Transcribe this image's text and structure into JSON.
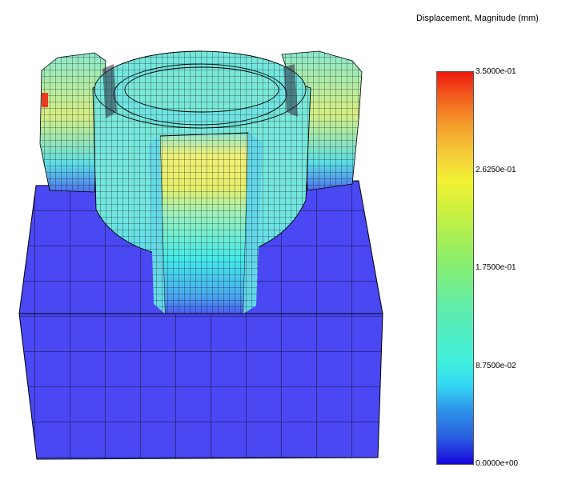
{
  "legend": {
    "title": "Displacement, Magnitude (mm)",
    "ticks": [
      "3.5000e-01",
      "2.6250e-01",
      "1.7500e-01",
      "8.7500e-02",
      "0.0000e+00"
    ],
    "min": 0.0,
    "max": 0.35
  },
  "colors": {
    "base_block": "#4a48f2",
    "ring_body": "#6ee6de",
    "slot_yellow": "#eef07a",
    "hotspot_red": "#e83a22",
    "mesh_line": "#000000"
  }
}
